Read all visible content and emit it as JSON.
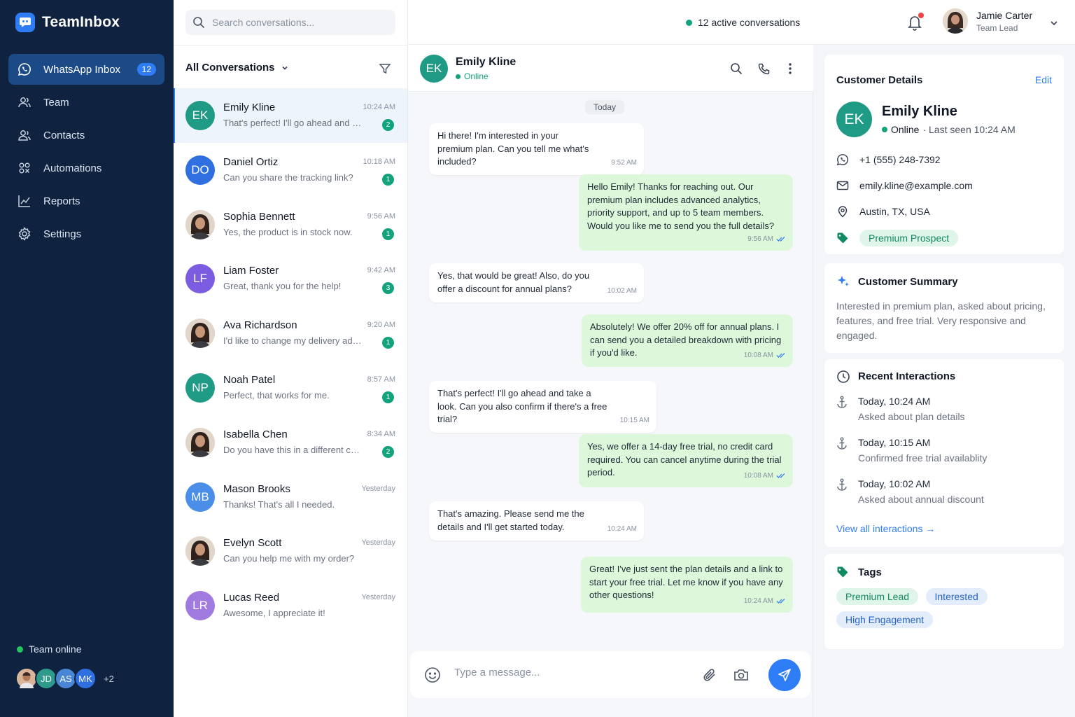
{
  "app": {
    "name": "TeamInbox"
  },
  "sidebar": {
    "items": [
      {
        "label": "WhatsApp Inbox",
        "badge": "12",
        "icon": "whatsapp-icon"
      },
      {
        "label": "Team",
        "icon": "team-icon"
      },
      {
        "label": "Contacts",
        "icon": "contacts-icon"
      },
      {
        "label": "Automations",
        "icon": "automations-icon"
      },
      {
        "label": "Reports",
        "icon": "reports-icon"
      },
      {
        "label": "Settings",
        "icon": "settings-icon"
      }
    ],
    "team_online_label": "Team online",
    "team_avatars": [
      "JD",
      "AS",
      "MK"
    ],
    "team_more": "+2"
  },
  "search": {
    "placeholder": "Search conversations..."
  },
  "list": {
    "filter_label": "All Conversations",
    "conversations": [
      {
        "initials": "EK",
        "name": "Emily Kline",
        "time": "10:24 AM",
        "preview": "That's perfect! I'll go ahead and take a look.",
        "unread": "2",
        "color": "#1f9a84",
        "photo": false
      },
      {
        "initials": "DO",
        "name": "Daniel Ortiz",
        "time": "10:18 AM",
        "preview": "Can you share the tracking link?",
        "unread": "1",
        "color": "#2f6fe0",
        "photo": false
      },
      {
        "initials": "",
        "name": "Sophia Bennett",
        "time": "9:56 AM",
        "preview": "Yes, the product is in stock now.",
        "unread": "1",
        "color": "#d9c6b8",
        "photo": true
      },
      {
        "initials": "LF",
        "name": "Liam Foster",
        "time": "9:42 AM",
        "preview": "Great, thank you for the help!",
        "unread": "3",
        "color": "#7c5ce0",
        "photo": false
      },
      {
        "initials": "",
        "name": "Ava Richardson",
        "time": "9:20 AM",
        "preview": "I'd like to change my delivery address.",
        "unread": "1",
        "color": "#d9c6b8",
        "photo": true
      },
      {
        "initials": "NP",
        "name": "Noah Patel",
        "time": "8:57 AM",
        "preview": "Perfect, that works for me.",
        "unread": "1",
        "color": "#1f9a84",
        "photo": false
      },
      {
        "initials": "",
        "name": "Isabella Chen",
        "time": "8:34 AM",
        "preview": "Do you have this in a different color?",
        "unread": "2",
        "color": "#d9c6b8",
        "photo": true
      },
      {
        "initials": "MB",
        "name": "Mason Brooks",
        "time": "Yesterday",
        "preview": "Thanks! That's all I needed.",
        "unread": "",
        "color": "#4a8ee8",
        "photo": false
      },
      {
        "initials": "",
        "name": "Evelyn Scott",
        "time": "Yesterday",
        "preview": "Can you help me with my order?",
        "unread": "",
        "color": "#d9c6b8",
        "photo": true
      },
      {
        "initials": "LR",
        "name": "Lucas Reed",
        "time": "Yesterday",
        "preview": "Awesome, I appreciate it!",
        "unread": "",
        "color": "#a17ae0",
        "photo": false
      }
    ]
  },
  "topbar": {
    "active_conversations": "12 active conversations",
    "user_name": "Jamie Carter",
    "user_role": "Team Lead"
  },
  "chat": {
    "contact_initials": "EK",
    "contact_name": "Emily Kline",
    "contact_status": "Online",
    "day_label": "Today",
    "messages": [
      {
        "dir": "in",
        "text": "Hi there! I'm interested in your premium plan. Can you tell me what's included?",
        "time": "9:52 AM"
      },
      {
        "dir": "out",
        "text": "Hello Emily! Thanks for reaching out. Our premium plan includes advanced analytics, priority support, and up to 5 team members. Would you like me to send you the full details?",
        "time": "9:56 AM"
      },
      {
        "dir": "in",
        "text": "Yes, that would be great! Also, do you offer a discount for annual plans?",
        "time": "10:02 AM"
      },
      {
        "dir": "out",
        "text": "Absolutely! We offer 20% off for annual plans. I can send you a detailed breakdown with pricing if you'd like.",
        "time": "10:08 AM"
      },
      {
        "dir": "in",
        "text": "That's perfect! I'll go ahead and take a look. Can you also confirm if there's a free trial?",
        "time": "10:15 AM"
      },
      {
        "dir": "out",
        "text": "Yes, we offer a 14-day free trial, no credit card required. You can cancel anytime during the trial period.",
        "time": "10:08 AM"
      },
      {
        "dir": "in",
        "text": "That's amazing. Please send me the details and I'll get started today.",
        "time": "10:24 AM"
      },
      {
        "dir": "out",
        "text": "Great! I've just sent the plan details and a link to start your free trial. Let me know if you have any other questions!",
        "time": "10:24 AM"
      }
    ],
    "composer_placeholder": "Type a message..."
  },
  "details": {
    "title": "Customer Details",
    "edit_label": "Edit",
    "initials": "EK",
    "name": "Emily Kline",
    "status": "Online",
    "last_seen": "· Last seen 10:24 AM",
    "phone": "+1 (555) 248-7392",
    "email": "emily.kline@example.com",
    "location": "Austin, TX, USA",
    "tag": "Premium Prospect"
  },
  "summary": {
    "title": "Customer Summary",
    "text": "Interested in premium plan, asked about pricing, features, and free trial. Very responsive and engaged."
  },
  "interactions": {
    "title": "Recent Interactions",
    "items": [
      {
        "time": "Today, 10:24 AM",
        "desc": "Asked about plan details"
      },
      {
        "time": "Today, 10:15 AM",
        "desc": "Confirmed free trial availablity"
      },
      {
        "time": "Today, 10:02 AM",
        "desc": "Asked about annual discount"
      }
    ],
    "view_all": "View all interactions →"
  },
  "tags": {
    "title": "Tags",
    "items": [
      {
        "label": "Premium Lead",
        "color": "green"
      },
      {
        "label": "Interested",
        "color": "blue"
      },
      {
        "label": "High Engagement",
        "color": "blue"
      }
    ]
  },
  "colors": {
    "accent": "#2f7df6",
    "sidebar_bg": "#0f2340",
    "online": "#22c55e",
    "outgoing_bubble": "#dcf7d9"
  }
}
